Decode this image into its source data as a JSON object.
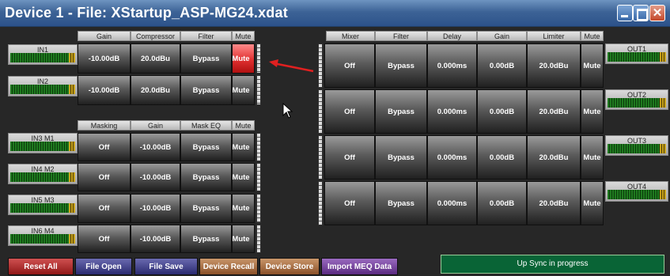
{
  "title": "Device 1  -  File: XStartup_ASP-MG24.xdat",
  "input_headers": [
    "Gain",
    "Compressor",
    "Filter",
    "Mute"
  ],
  "masking_headers": [
    "Masking",
    "Gain",
    "Mask EQ",
    "Mute"
  ],
  "output_headers": [
    "Mixer",
    "Filter",
    "Delay",
    "Gain",
    "Limiter",
    "Mute"
  ],
  "inputs": [
    {
      "name": "IN1",
      "gain": "-10.00dB",
      "compressor": "20.0dBu",
      "filter": "Bypass",
      "mute": "Mute",
      "muted": true
    },
    {
      "name": "IN2",
      "gain": "-10.00dB",
      "compressor": "20.0dBu",
      "filter": "Bypass",
      "mute": "Mute",
      "muted": false
    }
  ],
  "masks": [
    {
      "name": "IN3 M1",
      "masking": "Off",
      "gain": "-10.00dB",
      "eq": "Bypass",
      "mute": "Mute"
    },
    {
      "name": "IN4 M2",
      "masking": "Off",
      "gain": "-10.00dB",
      "eq": "Bypass",
      "mute": "Mute"
    },
    {
      "name": "IN5 M3",
      "masking": "Off",
      "gain": "-10.00dB",
      "eq": "Bypass",
      "mute": "Mute"
    },
    {
      "name": "IN6 M4",
      "masking": "Off",
      "gain": "-10.00dB",
      "eq": "Bypass",
      "mute": "Mute"
    }
  ],
  "outputs": [
    {
      "name": "OUT1",
      "mixer": "Off",
      "filter": "Bypass",
      "delay": "0.000ms",
      "gain": "0.00dB",
      "limiter": "20.0dBu",
      "mute": "Mute"
    },
    {
      "name": "OUT2",
      "mixer": "Off",
      "filter": "Bypass",
      "delay": "0.000ms",
      "gain": "0.00dB",
      "limiter": "20.0dBu",
      "mute": "Mute"
    },
    {
      "name": "OUT3",
      "mixer": "Off",
      "filter": "Bypass",
      "delay": "0.000ms",
      "gain": "0.00dB",
      "limiter": "20.0dBu",
      "mute": "Mute"
    },
    {
      "name": "OUT4",
      "mixer": "Off",
      "filter": "Bypass",
      "delay": "0.000ms",
      "gain": "0.00dB",
      "limiter": "20.0dBu",
      "mute": "Mute"
    }
  ],
  "bottom": {
    "reset": "Reset All",
    "open": "File Open",
    "save": "File Save",
    "recall": "Device Recall",
    "store": "Device Store",
    "import": "Import MEQ Data",
    "status": "Up Sync in progress"
  },
  "colors": {
    "mute_active": "#e03030",
    "reset": "#b02020",
    "file": "#3a3a8a",
    "device": "#a06a3a",
    "import": "#6a3a8a",
    "status": "#096436",
    "titlebar": "#3d6396"
  }
}
